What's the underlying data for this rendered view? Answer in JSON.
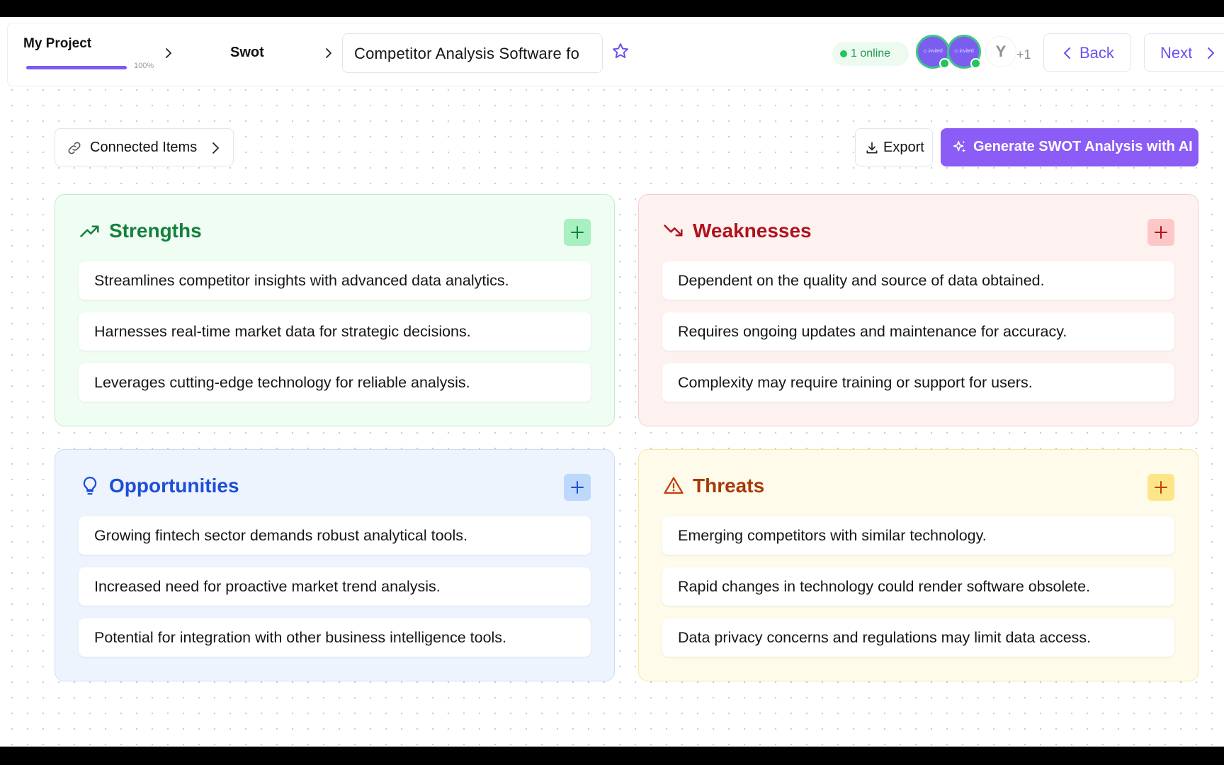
{
  "header": {
    "project_name": "My Project",
    "progress_label": "100%",
    "progress_value": 1.0,
    "breadcrumb_current": "Swot",
    "document_title": "Competitor Analysis Software fo",
    "online_label": "1 online",
    "avatar_initial": "Y",
    "more_users": "+1",
    "back_label": "Back",
    "next_label": "Next"
  },
  "toolbar": {
    "connected_label": "Connected Items",
    "export_label": "Export",
    "generate_label": "Generate SWOT Analysis with AI"
  },
  "colors": {
    "accent": "#8b5cf6",
    "strengths": "#15803d",
    "weaknesses": "#b0131c",
    "opportunities": "#1d4ed8",
    "threats": "#a63a0a"
  },
  "swot": {
    "strengths": {
      "title": "Strengths",
      "icon": "trending-up-icon",
      "items": [
        "Streamlines competitor insights with advanced data analytics.",
        "Harnesses real-time market data for strategic decisions.",
        "Leverages cutting-edge technology for reliable analysis."
      ]
    },
    "weaknesses": {
      "title": "Weaknesses",
      "icon": "trending-down-icon",
      "items": [
        "Dependent on the quality and source of data obtained.",
        "Requires ongoing updates and maintenance for accuracy.",
        "Complexity may require training or support for users."
      ]
    },
    "opportunities": {
      "title": "Opportunities",
      "icon": "lightbulb-icon",
      "items": [
        "Growing fintech sector demands robust analytical tools.",
        "Increased need for proactive market trend analysis.",
        "Potential for integration with other business intelligence tools."
      ]
    },
    "threats": {
      "title": "Threats",
      "icon": "warning-icon",
      "items": [
        "Emerging competitors with similar technology.",
        "Rapid changes in technology could render software obsolete.",
        "Data privacy concerns and regulations may limit data access."
      ]
    }
  }
}
